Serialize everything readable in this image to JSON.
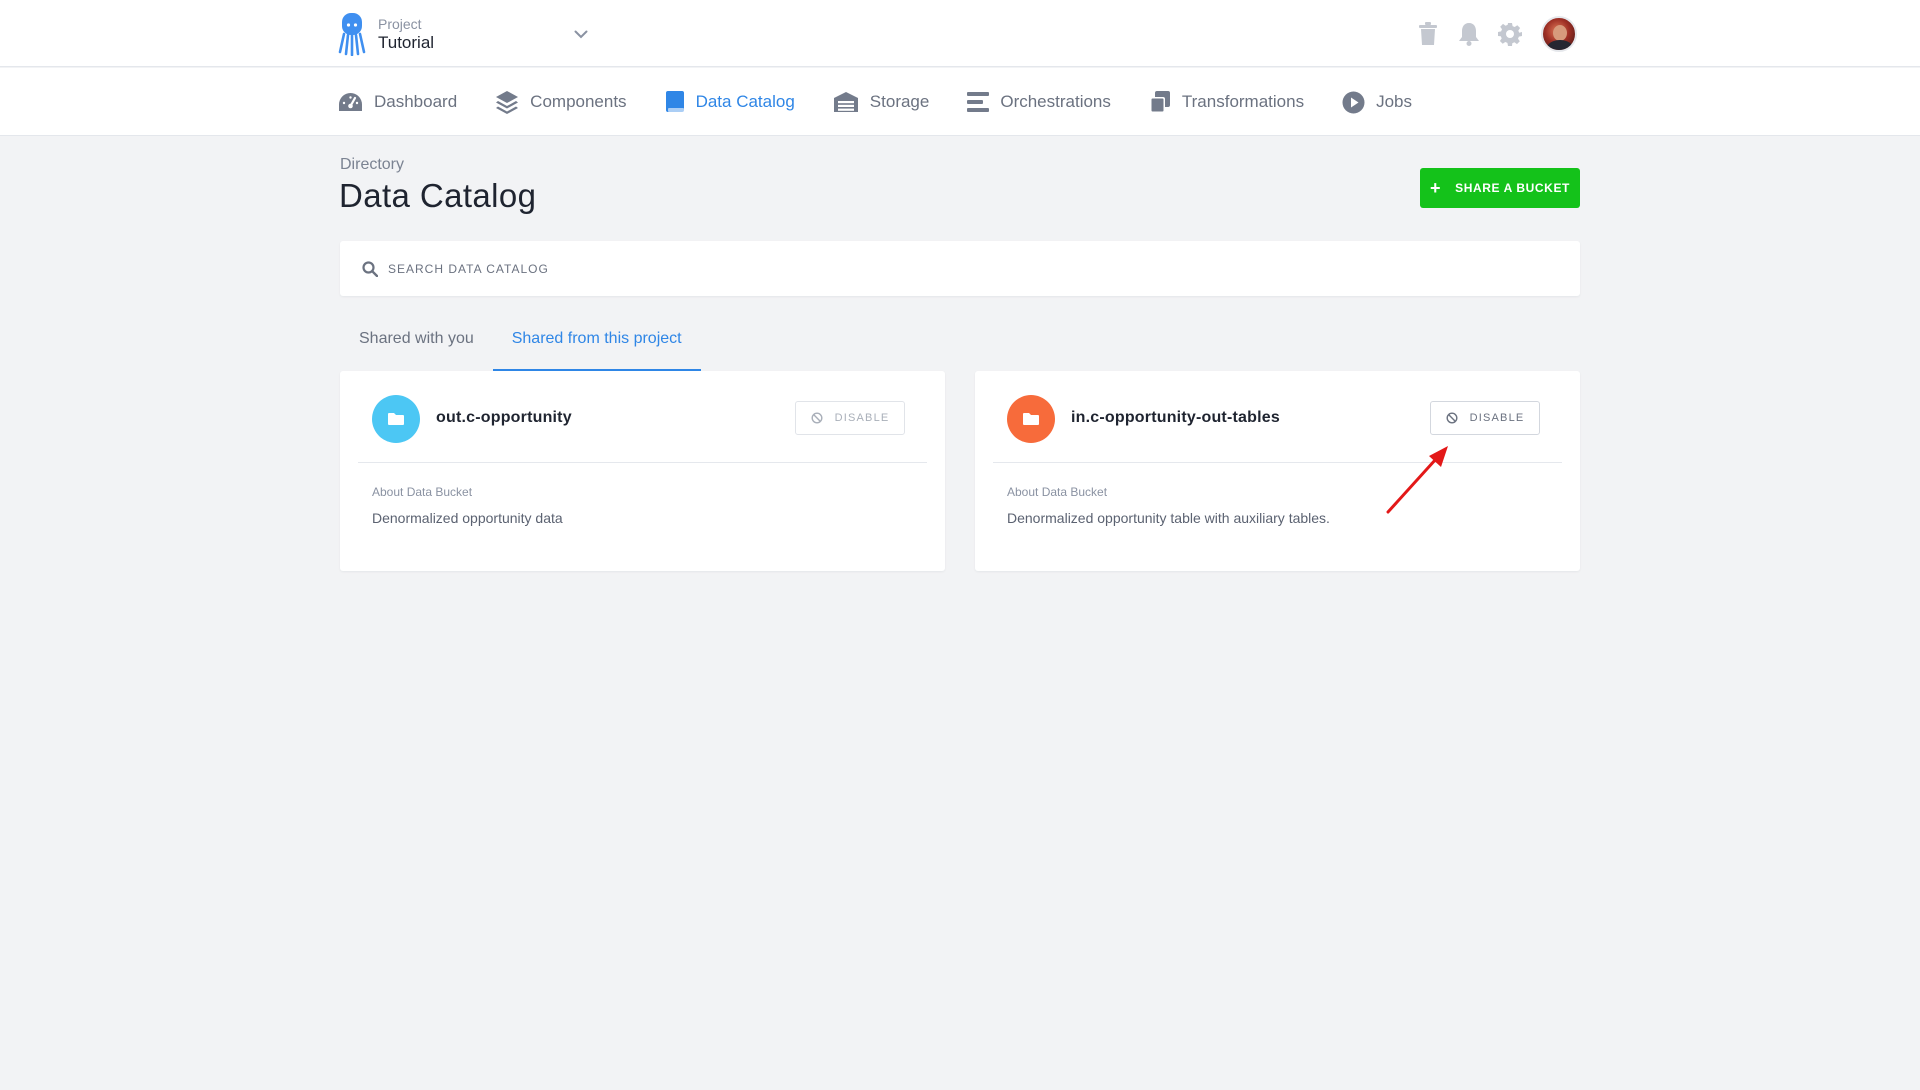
{
  "project": {
    "caption": "Project",
    "name": "Tutorial"
  },
  "nav": [
    {
      "label": "Dashboard",
      "icon": "gauge-icon"
    },
    {
      "label": "Components",
      "icon": "layers-icon"
    },
    {
      "label": "Data Catalog",
      "icon": "book-icon",
      "active": true
    },
    {
      "label": "Storage",
      "icon": "warehouse-icon"
    },
    {
      "label": "Orchestrations",
      "icon": "bars-icon"
    },
    {
      "label": "Transformations",
      "icon": "copy-icon"
    },
    {
      "label": "Jobs",
      "icon": "play-circle-icon"
    }
  ],
  "header": {
    "breadcrumb": "Directory",
    "title": "Data Catalog",
    "share_button": "SHARE A BUCKET"
  },
  "search": {
    "placeholder": "SEARCH DATA CATALOG",
    "value": ""
  },
  "tabs": [
    {
      "label": "Shared with you",
      "active": false
    },
    {
      "label": "Shared from this project",
      "active": true
    }
  ],
  "buckets": [
    {
      "name": "out.c-opportunity",
      "color": "#4cc7f4",
      "disable_label": "DISABLE",
      "about_label": "About Data Bucket",
      "description": "Denormalized opportunity data"
    },
    {
      "name": "in.c-opportunity-out-tables",
      "color": "#f76b3b",
      "disable_label": "DISABLE",
      "about_label": "About Data Bucket",
      "description": "Denormalized opportunity table with auxiliary tables."
    }
  ],
  "colors": {
    "accent": "#2f86e6",
    "share_button": "#14c21a",
    "annotation": "#e31818"
  }
}
